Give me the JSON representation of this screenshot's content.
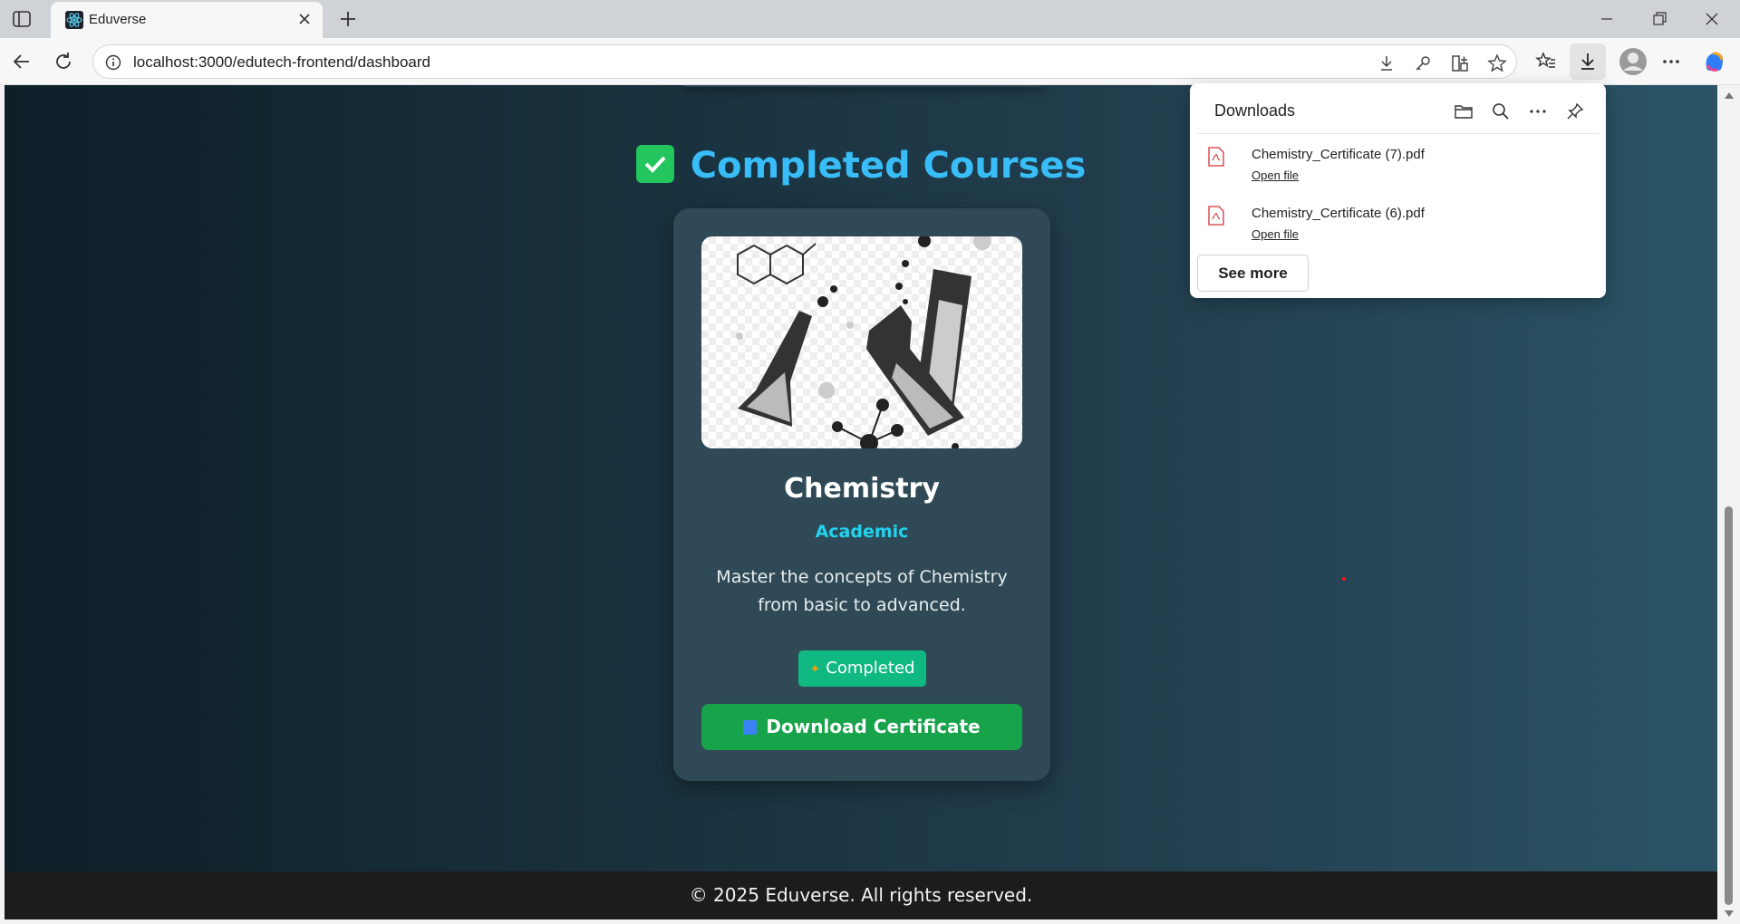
{
  "browser": {
    "tab_title": "Eduverse",
    "url": "localhost:3000/edutech-frontend/dashboard"
  },
  "page": {
    "section_title": "Completed Courses",
    "course": {
      "name": "Chemistry",
      "category": "Academic",
      "description": "Master the concepts of Chemistry from basic to advanced.",
      "status": "Completed",
      "download_label": "Download Certificate"
    },
    "footer": "© 2025 Eduverse. All rights reserved."
  },
  "downloads": {
    "title": "Downloads",
    "items": [
      {
        "filename": "Chemistry_Certificate (7).pdf",
        "action": "Open file"
      },
      {
        "filename": "Chemistry_Certificate (6).pdf",
        "action": "Open file"
      }
    ],
    "see_more": "See more"
  },
  "colors": {
    "accent": "#38bdf8",
    "category": "#22d3ee",
    "status_badge": "#10b981",
    "download_button": "#16a34a"
  }
}
